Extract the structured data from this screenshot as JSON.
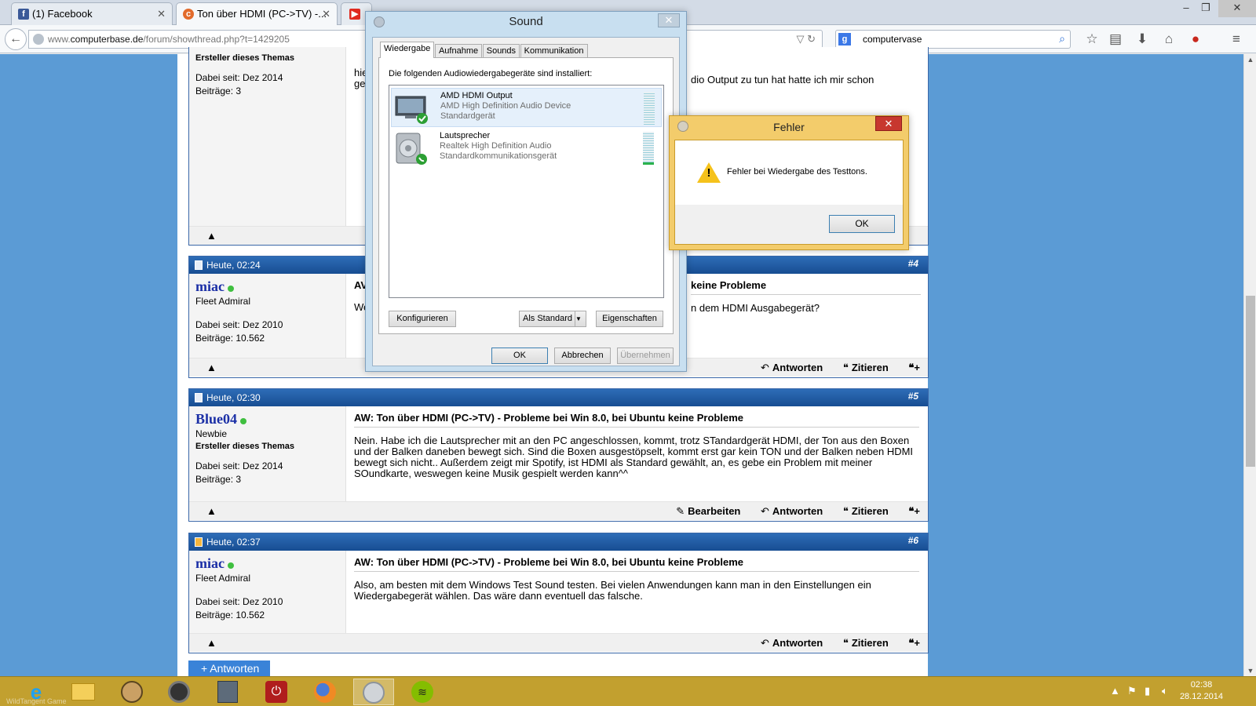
{
  "browser": {
    "tabs": [
      {
        "title": "(1) Facebook",
        "favicon": "facebook-icon",
        "close": "✕"
      },
      {
        "title": "Ton über HDMI (PC->TV) -...",
        "favicon": "computerbase-icon",
        "close": "✕"
      },
      {
        "title": "",
        "favicon": "youtube-icon"
      }
    ],
    "url_prefix": "www.",
    "url_domain": "computerbase.de",
    "url_path": "/forum/showthread.php?t=1429205",
    "search_value": "computervase",
    "window_controls": {
      "minimize": "–",
      "maximize": "❐",
      "close": "✕"
    }
  },
  "posts": [
    {
      "id": "p3",
      "date": "",
      "number": "",
      "user": {
        "name": "",
        "rank": "",
        "starter": "Ersteller dieses Themas",
        "joined": "Dabei seit: Dez 2014",
        "posts": "Beiträge: 3"
      },
      "title": "",
      "text_left": "hie",
      "text_left2": "ge",
      "text_right": "dio Output zu tun hat hatte ich mir schon",
      "actions": []
    },
    {
      "id": "p4",
      "date": "Heute, 02:24",
      "number": "#4",
      "user": {
        "name": "miac",
        "rank": "Fleet Admiral",
        "starter": "",
        "joined": "Dabei seit: Dez 2010",
        "posts": "Beiträge: 10.562"
      },
      "title_left": "AV",
      "title_right": "keine Probleme",
      "text_left": "We",
      "text_right": "n dem HDMI Ausgabegerät?",
      "actions": [
        {
          "icon": "reply-icon",
          "label": "Antworten"
        },
        {
          "icon": "quote-icon",
          "label": "Zitieren"
        }
      ]
    },
    {
      "id": "p5",
      "date": "Heute, 02:30",
      "number": "#5",
      "user": {
        "name": "Blue04",
        "rank": "Newbie",
        "starter": "Ersteller dieses Themas",
        "joined": "Dabei seit: Dez 2014",
        "posts": "Beiträge: 3"
      },
      "title": "AW: Ton über HDMI (PC->TV) - Probleme bei Win 8.0, bei Ubuntu keine Probleme",
      "text": "Nein. Habe ich die Lautsprecher mit an den PC angeschlossen, kommt, trotz STandardgerät HDMI, der Ton aus den Boxen und der Balken daneben bewegt sich. Sind die Boxen ausgestöpselt, kommt erst gar kein TON und der Balken neben HDMI bewegt sich nicht.. Außerdem zeigt mir Spotify, ist HDMI als Standard gewählt, an, es gebe ein Problem mit meiner SOundkarte, weswegen keine Musik gespielt werden kann^^",
      "actions": [
        {
          "icon": "edit-icon",
          "label": "Bearbeiten"
        },
        {
          "icon": "reply-icon",
          "label": "Antworten"
        },
        {
          "icon": "quote-icon",
          "label": "Zitieren"
        }
      ]
    },
    {
      "id": "p6",
      "date": "Heute, 02:37",
      "number": "#6",
      "user": {
        "name": "miac",
        "rank": "Fleet Admiral",
        "starter": "",
        "joined": "Dabei seit: Dez 2010",
        "posts": "Beiträge: 10.562"
      },
      "title": "AW: Ton über HDMI (PC->TV) - Probleme bei Win 8.0, bei Ubuntu keine Probleme",
      "text": "Also, am besten mit dem Windows Test Sound testen. Bei vielen Anwendungen kann man in den Einstellungen ein Wiedergabegerät wählen. Das wäre dann eventuell das falsche.",
      "actions": [
        {
          "icon": "reply-icon",
          "label": "Antworten"
        },
        {
          "icon": "quote-icon",
          "label": "Zitieren"
        }
      ]
    }
  ],
  "reply_button": "+ Antworten",
  "sound_dialog": {
    "title": "Sound",
    "close": "✕",
    "tabs": [
      "Wiedergabe",
      "Aufnahme",
      "Sounds",
      "Kommunikation"
    ],
    "active_tab": "Wiedergabe",
    "instruction": "Die folgenden Audiowiedergabegeräte sind installiert:",
    "devices": [
      {
        "name": "AMD HDMI Output",
        "desc": "AMD High Definition Audio Device",
        "status": "Standardgerät",
        "icon": "monitor-icon",
        "badge": "default-check-icon",
        "level": 0.0
      },
      {
        "name": "Lautsprecher",
        "desc": "Realtek High Definition Audio",
        "status": "Standardkommunikationsgerät",
        "icon": "speaker-icon",
        "badge": "comms-phone-icon",
        "level": 0.08
      }
    ],
    "buttons": {
      "configure": "Konfigurieren",
      "set_default": "Als Standard",
      "properties": "Eigenschaften",
      "ok": "OK",
      "cancel": "Abbrechen",
      "apply": "Übernehmen"
    }
  },
  "error_dialog": {
    "title": "Fehler",
    "close": "✕",
    "message": "Fehler bei Wiedergabe des Testtons.",
    "ok": "OK"
  },
  "taskbar": {
    "watermark": "WildTangent Game",
    "clock_time": "02:38",
    "clock_date": "28.12.2014",
    "apps": [
      "ie-icon",
      "explorer-icon",
      "media-center-icon",
      "audio-app-icon",
      "docs-icon",
      "power-app-icon",
      "firefox-icon",
      "sound-icon",
      "spotify-icon"
    ],
    "active_app": "sound-icon"
  },
  "colors": {
    "page_bg": "#5b9bd5",
    "post_header": "#2563a8",
    "username": "#1b2fa6",
    "taskbar": "#c2a02f",
    "error_frame": "#f3cc6b"
  }
}
